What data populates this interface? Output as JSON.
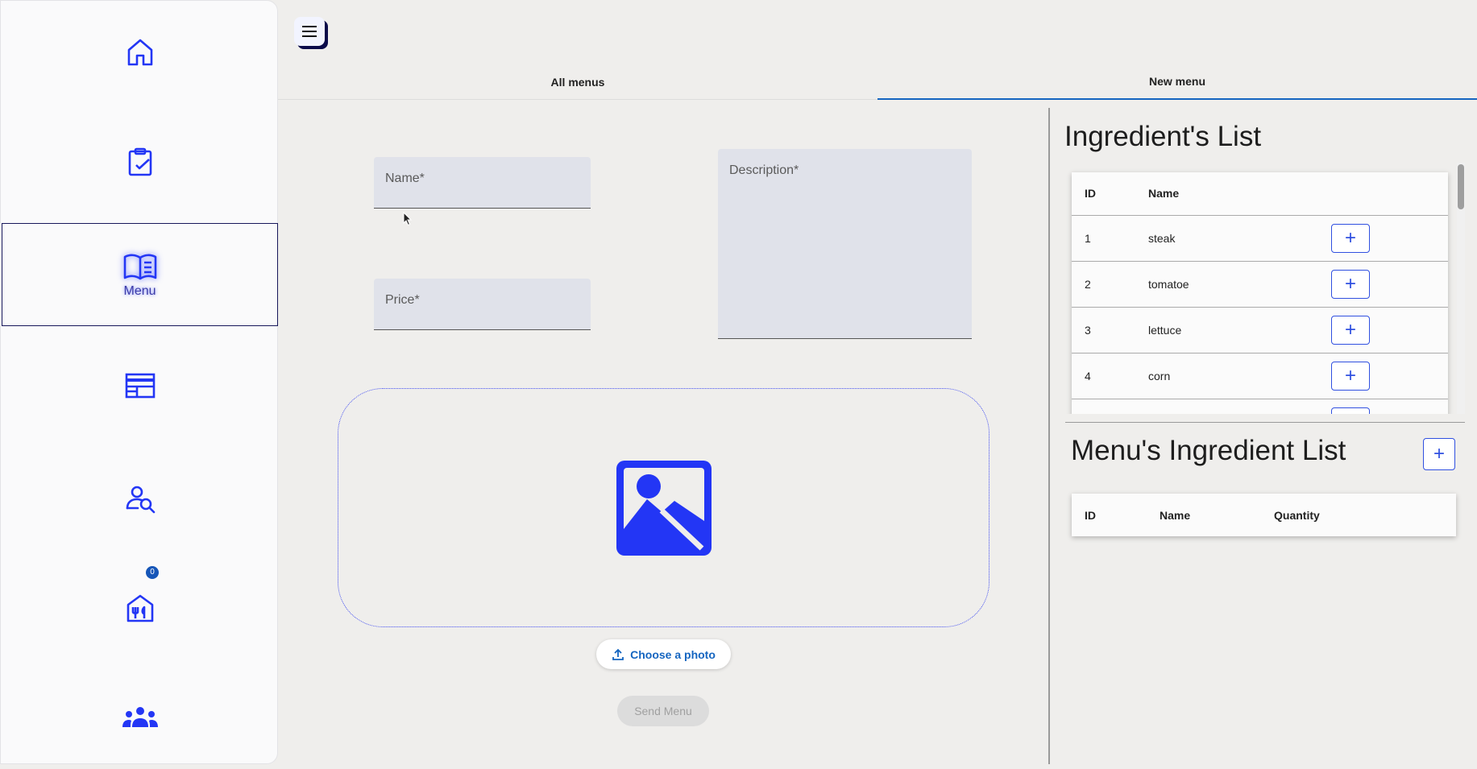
{
  "sidebar": {
    "items": [
      {
        "icon": "home-icon",
        "label": ""
      },
      {
        "icon": "clipboard-check-icon",
        "label": ""
      },
      {
        "icon": "menu-book-icon",
        "label": "Menu"
      },
      {
        "icon": "calendar-table-icon",
        "label": ""
      },
      {
        "icon": "user-search-icon",
        "label": ""
      },
      {
        "icon": "restaurant-icon",
        "label": "",
        "badge": "0"
      },
      {
        "icon": "group-icon",
        "label": ""
      }
    ],
    "active_index": 2
  },
  "header": {
    "menu_icon": "hamburger-icon"
  },
  "tabs": [
    {
      "label": "All menus",
      "active": false
    },
    {
      "label": "New menu",
      "active": true
    }
  ],
  "form": {
    "name_label": "Name*",
    "price_label": "Price*",
    "description_label": "Description*",
    "photo_icon": "image-icon",
    "choose_photo_label": "Choose a photo",
    "send_label": "Send Menu"
  },
  "ingredients": {
    "title": "Ingredient's List",
    "columns": [
      "ID",
      "Name"
    ],
    "rows": [
      {
        "id": "1",
        "name": "steak"
      },
      {
        "id": "2",
        "name": "tomatoe"
      },
      {
        "id": "3",
        "name": "lettuce"
      },
      {
        "id": "4",
        "name": "corn"
      },
      {
        "id": "",
        "name": ""
      }
    ],
    "add_label": "+"
  },
  "menu_ingredients": {
    "title": "Menu's Ingredient List",
    "add_label": "+",
    "columns": [
      "ID",
      "Name",
      "Quantity"
    ]
  },
  "colors": {
    "accent": "#2336f5",
    "tab_indicator": "#1565c0",
    "background": "#efeeec"
  }
}
